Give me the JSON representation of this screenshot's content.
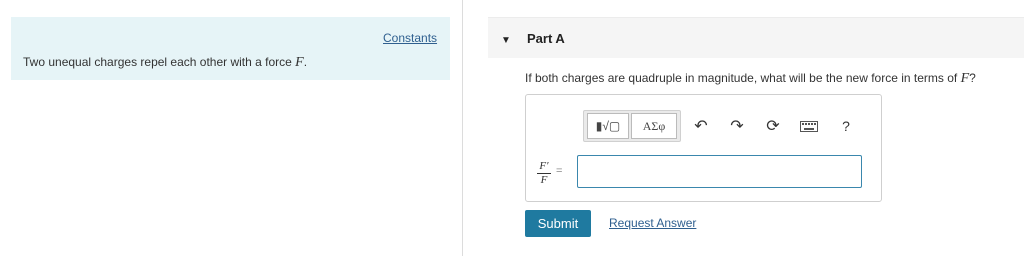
{
  "problem": {
    "constants_link": "Constants",
    "statement": "Two unequal charges repel each other with a force ",
    "force_var": "F",
    "statement_end": "."
  },
  "part": {
    "toggle_icon": "caret-down-icon",
    "title": "Part A",
    "question": "If both charges are quadruple in magnitude, what will be the new force in terms of ",
    "question_var": "F",
    "question_end": "?"
  },
  "toolbar": {
    "templates_label": "▮√▢",
    "symbols_label": "ΑΣφ",
    "undo_icon": "undo-icon",
    "redo_icon": "redo-icon",
    "reset_icon": "reset-icon",
    "keyboard_icon": "keyboard-icon",
    "help_label": "?"
  },
  "answer": {
    "fraction_numerator": "F′",
    "fraction_denominator": "F",
    "equals": "=",
    "value": ""
  },
  "actions": {
    "submit_label": "Submit",
    "request_answer_label": "Request Answer"
  },
  "colors": {
    "left_panel_bg": "#e6f4f7",
    "submit_bg": "#1f7aa0",
    "link": "#2f5f8f",
    "input_border": "#3a87ad"
  }
}
